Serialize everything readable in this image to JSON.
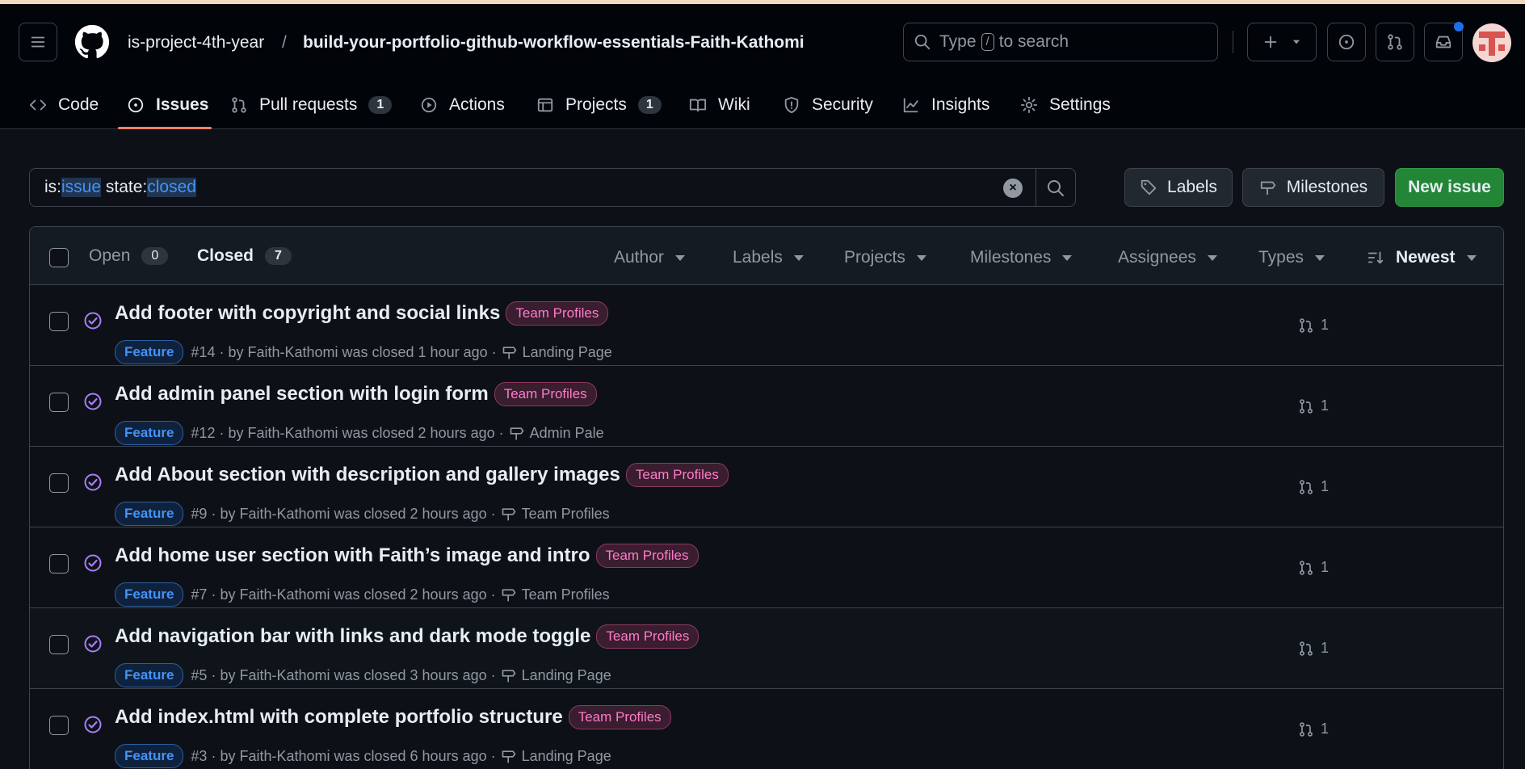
{
  "header": {
    "owner": "is-project-4th-year",
    "separator": "/",
    "repo": "build-your-portfolio-github-workflow-essentials-Faith-Kathomi",
    "search_prefix": "Type",
    "search_key": "/",
    "search_suffix": "to search"
  },
  "nav": {
    "code": "Code",
    "issues": "Issues",
    "pull_requests": "Pull requests",
    "pull_requests_count": "1",
    "actions": "Actions",
    "projects": "Projects",
    "projects_count": "1",
    "wiki": "Wiki",
    "security": "Security",
    "insights": "Insights",
    "settings": "Settings"
  },
  "filter": {
    "p1": "is:",
    "v1": "issue",
    "p2": " state:",
    "v2": "closed"
  },
  "buttons": {
    "labels": "Labels",
    "milestones": "Milestones",
    "new_issue": "New issue"
  },
  "list_header": {
    "open_label": "Open",
    "open_count": "0",
    "closed_label": "Closed",
    "closed_count": "7",
    "filters": {
      "author": "Author",
      "labels": "Labels",
      "projects": "Projects",
      "milestones": "Milestones",
      "assignees": "Assignees",
      "types": "Types",
      "sort": "Newest"
    }
  },
  "issues": [
    {
      "title": "Add footer with copyright and social links",
      "label": "Team Profiles",
      "type": "Feature",
      "meta": "#14 · by Faith-Kathomi was closed 1 hour ago ·",
      "milestone": "Landing Page",
      "prs": "1"
    },
    {
      "title": "Add admin panel section with login form",
      "label": "Team Profiles",
      "type": "Feature",
      "meta": "#12 · by Faith-Kathomi was closed 2 hours ago ·",
      "milestone": "Admin Pale",
      "prs": "1"
    },
    {
      "title": "Add About section with description and gallery images",
      "label": "Team Profiles",
      "type": "Feature",
      "meta": "#9 · by Faith-Kathomi was closed 2 hours ago ·",
      "milestone": "Team Profiles",
      "prs": "1"
    },
    {
      "title": "Add home user section with Faith’s image and intro",
      "label": "Team Profiles",
      "type": "Feature",
      "meta": "#7 · by Faith-Kathomi was closed 2 hours ago ·",
      "milestone": "Team Profiles",
      "prs": "1"
    },
    {
      "title": "Add navigation bar with links and dark mode toggle",
      "label": "Team Profiles",
      "type": "Feature",
      "meta": "#5 · by Faith-Kathomi was closed 3 hours ago ·",
      "milestone": "Landing Page",
      "prs": "1"
    },
    {
      "title": "Add index.html with complete portfolio structure",
      "label": "Team Profiles",
      "type": "Feature",
      "meta": "#3 · by Faith-Kathomi was closed 6 hours ago ·",
      "milestone": "Landing Page",
      "prs": "1"
    }
  ],
  "colors": {
    "accent_green": "#238636",
    "closed_purple": "#ab7df8",
    "link_blue": "#4493f8",
    "tab_underline": "#f78166"
  }
}
